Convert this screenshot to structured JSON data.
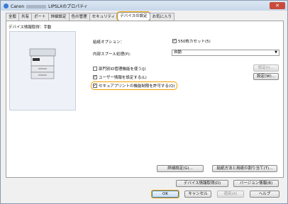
{
  "window": {
    "title_prefix": "Canon",
    "title_suffix": "LIPSLXのプロパティ",
    "close": "✕"
  },
  "tabs": [
    {
      "label": "全般"
    },
    {
      "label": "共有"
    },
    {
      "label": "ポート"
    },
    {
      "label": "詳細設定"
    },
    {
      "label": "色の管理"
    },
    {
      "label": "セキュリティ"
    },
    {
      "label": "デバイスの設定"
    },
    {
      "label": "お気に入り"
    }
  ],
  "panel": {
    "mode_label": "デバイス情報取得：手動",
    "finishing_label": "給紙オプション：",
    "finishing_value": "550枚カセット(5)",
    "spool_label": "内部スプール処理(P):",
    "spool_value": "自動",
    "dept_id_label": "部門別ID管理機能を使う(J)",
    "user_info_label": "ユーザー情報を設定する(L)",
    "secure_print_label": "セキュアプリントの機能制限を許可する(Q)",
    "settings_btn": "設定(I)...",
    "settings2_btn": "設定(W)..."
  },
  "bottom": {
    "detail_btn": "詳細設定(G)...",
    "paper_btn": "給紙方法と用紙の割り当て(T)..."
  },
  "footer": {
    "device_info_btn": "デバイス情報取得(D)",
    "version_btn": "バージョン情報(B)",
    "ok_btn": "OK",
    "cancel_btn": "キャンセル",
    "apply_btn": "適用(A)",
    "help_btn": "ヘルプ"
  }
}
